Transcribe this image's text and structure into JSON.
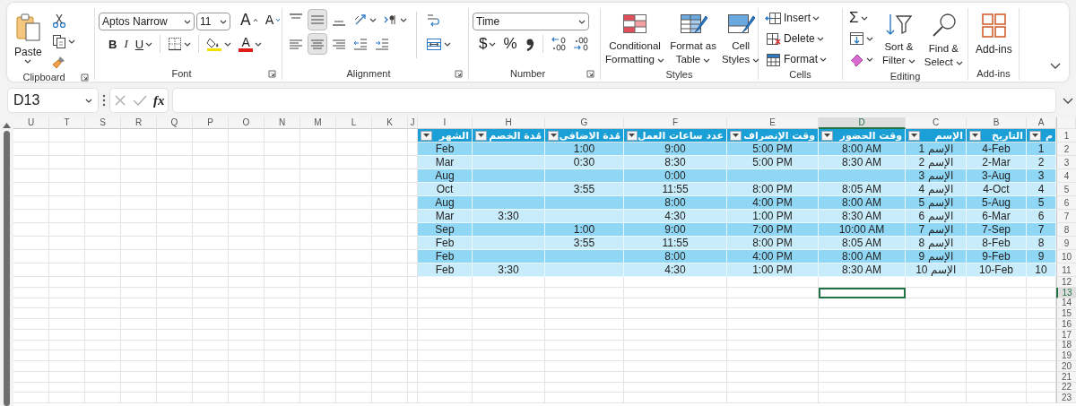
{
  "ribbon": {
    "clipboard": {
      "label": "Clipboard",
      "paste": "Paste"
    },
    "font": {
      "label": "Font",
      "font_name": "Aptos Narrow",
      "font_size": "11",
      "grow": "A",
      "shrink": "A",
      "bold": "B",
      "italic": "I",
      "underline": "U",
      "font_color": "A"
    },
    "alignment": {
      "label": "Alignment",
      "vertical_align": [
        {
          "selected": false
        },
        {
          "selected": true
        },
        {
          "selected": false
        }
      ],
      "horizontal_align": [
        {
          "selected": false
        },
        {
          "selected": true
        },
        {
          "selected": false
        }
      ]
    },
    "number": {
      "label": "Number",
      "format": "Time",
      "currency": "$",
      "percent": "%"
    },
    "styles": {
      "label": "Styles",
      "buttons": [
        [
          "Conditional",
          "Formatting"
        ],
        [
          "Format as",
          "Table"
        ],
        [
          "Cell",
          "Styles"
        ]
      ]
    },
    "cells": {
      "label": "Cells",
      "buttons": [
        "Insert",
        "Delete",
        "Format"
      ]
    },
    "editing": {
      "label": "Editing",
      "autosum": "Σ",
      "buttons": [
        [
          "Sort &",
          "Filter"
        ],
        [
          "Find &",
          "Select"
        ]
      ]
    },
    "add_ins": {
      "label": "Add-ins",
      "button": "Add-ins"
    }
  },
  "formula_bar": {
    "name_box": "D13",
    "function_label": "fx"
  },
  "column_headers": [
    {
      "label": "U",
      "selected": false
    },
    {
      "label": "T",
      "selected": false
    },
    {
      "label": "S",
      "selected": false
    },
    {
      "label": "R",
      "selected": false
    },
    {
      "label": "Q",
      "selected": false
    },
    {
      "label": "P",
      "selected": false
    },
    {
      "label": "O",
      "selected": false
    },
    {
      "label": "N",
      "selected": false
    },
    {
      "label": "M",
      "selected": false
    },
    {
      "label": "L",
      "selected": false
    },
    {
      "label": "K",
      "selected": false
    },
    {
      "label": "J",
      "selected": false
    },
    {
      "label": "I",
      "selected": false
    },
    {
      "label": "H",
      "selected": false
    },
    {
      "label": "G",
      "selected": false
    },
    {
      "label": "F",
      "selected": false
    },
    {
      "label": "E",
      "selected": false
    },
    {
      "label": "D",
      "selected": true
    },
    {
      "label": "C",
      "selected": false
    },
    {
      "label": "B",
      "selected": false
    },
    {
      "label": "A",
      "selected": false
    }
  ],
  "row_headers": [
    {
      "label": "1",
      "selected": false
    },
    {
      "label": "2",
      "selected": false
    },
    {
      "label": "3",
      "selected": false
    },
    {
      "label": "4",
      "selected": false
    },
    {
      "label": "5",
      "selected": false
    },
    {
      "label": "6",
      "selected": false
    },
    {
      "label": "7",
      "selected": false
    },
    {
      "label": "8",
      "selected": false
    },
    {
      "label": "9",
      "selected": false
    },
    {
      "label": "10",
      "selected": false
    },
    {
      "label": "11",
      "selected": false
    },
    {
      "label": "12",
      "selected": false
    },
    {
      "label": "13",
      "selected": true
    },
    {
      "label": "14",
      "selected": false
    },
    {
      "label": "15",
      "selected": false
    },
    {
      "label": "16",
      "selected": false
    },
    {
      "label": "17",
      "selected": false
    },
    {
      "label": "18",
      "selected": false
    },
    {
      "label": "19",
      "selected": false
    },
    {
      "label": "20",
      "selected": false
    },
    {
      "label": "21",
      "selected": false
    },
    {
      "label": "22",
      "selected": false
    },
    {
      "label": "23",
      "selected": false
    }
  ],
  "table": {
    "columns": [
      "الشهر",
      "مُدة الخصم",
      "مُدة الاضافى",
      "عدد ساعات العمل",
      "وقت الإنصراف",
      "وقت الحضور",
      "الإسم",
      "التاريخ",
      "م"
    ],
    "rows": [
      [
        "Feb",
        null,
        "1:00",
        "9:00",
        "5:00 PM",
        "8:00 AM",
        "الإسم 1",
        "4-Feb",
        "1"
      ],
      [
        "Mar",
        null,
        "0:30",
        "8:30",
        "5:00 PM",
        "8:30 AM",
        "الإسم 2",
        "2-Mar",
        "2"
      ],
      [
        "Aug",
        null,
        null,
        "0:00",
        null,
        null,
        "الإسم 3",
        "3-Aug",
        "3"
      ],
      [
        "Oct",
        null,
        "3:55",
        "11:55",
        "8:00 PM",
        "8:05 AM",
        "الإسم 4",
        "4-Oct",
        "4"
      ],
      [
        "Aug",
        null,
        null,
        "8:00",
        "4:00 PM",
        "8:00 AM",
        "الإسم 5",
        "5-Aug",
        "5"
      ],
      [
        "Mar",
        "3:30",
        null,
        "4:30",
        "1:00 PM",
        "8:30 AM",
        "الإسم 6",
        "6-Mar",
        "6"
      ],
      [
        "Sep",
        null,
        "1:00",
        "9:00",
        "7:00 PM",
        "10:00 AM",
        "الإسم 7",
        "7-Sep",
        "7"
      ],
      [
        "Feb",
        null,
        "3:55",
        "11:55",
        "8:00 PM",
        "8:05 AM",
        "الإسم 8",
        "8-Feb",
        "8"
      ],
      [
        "Feb",
        null,
        null,
        "8:00",
        "4:00 PM",
        "8:00 AM",
        "الإسم 9",
        "9-Feb",
        "9"
      ],
      [
        "Feb",
        "3:30",
        null,
        "4:30",
        "1:00 PM",
        "8:30 AM",
        "الإسم 10",
        "10-Feb",
        "10"
      ]
    ]
  }
}
